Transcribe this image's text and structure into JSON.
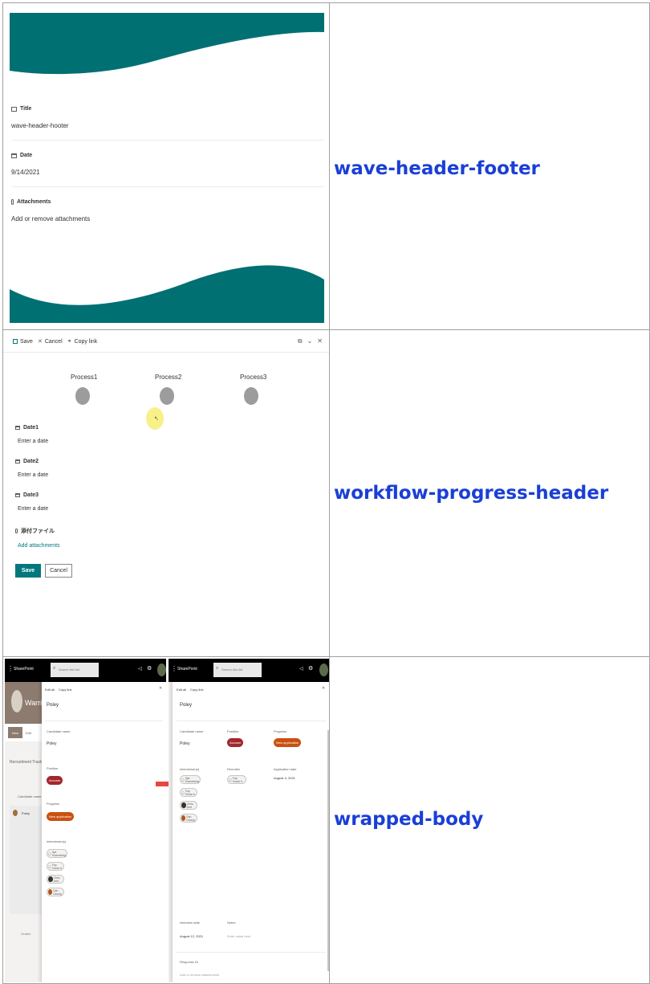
{
  "rows": [
    {
      "link": "wave-header-footer"
    },
    {
      "link": "workflow-progress-header"
    },
    {
      "link": "wrapped-body"
    }
  ],
  "wave": {
    "colors": {
      "teal": "#007073"
    },
    "fields": [
      {
        "label": "Title",
        "value": "wave-header-hooter",
        "icon": "text-field-icon"
      },
      {
        "label": "Date",
        "value": "9/14/2021",
        "icon": "calendar-icon"
      },
      {
        "label": "Attachments",
        "value": "Add or remove attachments",
        "icon": "paperclip-icon"
      }
    ]
  },
  "workflow": {
    "toolbar": {
      "save": "Save",
      "cancel": "Cancel",
      "copy_link": "Copy link"
    },
    "steps": [
      "Process1",
      "Process2",
      "Process3"
    ],
    "fields": [
      {
        "label": "Date1",
        "value": "Enter a date"
      },
      {
        "label": "Date2",
        "value": "Enter a date"
      },
      {
        "label": "Date3",
        "value": "Enter a date"
      },
      {
        "label": "添付ファイル",
        "value": "Add attachments"
      }
    ],
    "buttons": {
      "save": "Save",
      "cancel": "Cancel"
    },
    "colors": {
      "accent": "#03787c",
      "step": "#9c9c9c",
      "cursor": "#f6f07a"
    }
  },
  "wrapped": {
    "left": {
      "brand": "SharePoint",
      "search_placeholder": "Search this list",
      "site_name": "Warrior",
      "new_label": "New",
      "edit_label": "Edit",
      "list_title": "Recruitment Tracker",
      "col_header": "Candidate name",
      "row_name": "Poley",
      "footer": "Seattle",
      "toolbar": {
        "edit_all": "Edit all",
        "copy_link": "Copy link"
      },
      "title": "Poley",
      "fields": [
        {
          "label": "Candidate name",
          "value": "Poley"
        },
        {
          "label": "Position",
          "value": "Accuser"
        },
        {
          "label": "Progress",
          "value": "New application"
        },
        {
          "label": "Interviewer(s)",
          "people": [
            "Ilya Hoeneberg",
            "Fay Horse b",
            "Chris Arnt",
            "Dan Gaung"
          ]
        }
      ]
    },
    "right": {
      "brand": "SharePoint",
      "search_placeholder": "Search this list",
      "toolbar": {
        "edit_all": "Edit all",
        "copy_link": "Copy link"
      },
      "title": "Poley",
      "fields": [
        {
          "label": "Candidate name",
          "value": "Poley"
        },
        {
          "label": "Position",
          "value": "Accuser"
        },
        {
          "label": "Progress",
          "value": "New application"
        },
        {
          "label": "Interviewer(s)",
          "people": [
            "Ilya Hoeneberg",
            "Fay Horse b",
            "Chris Arnt",
            "Dan Gaung"
          ]
        },
        {
          "label": "Recruiter",
          "people": [
            "Fay Horse b"
          ]
        },
        {
          "label": "Application date",
          "value": "August 4, 2021"
        },
        {
          "label": "Interview date",
          "value": "August 12, 2021"
        },
        {
          "label": "Notes",
          "value": "Enter value here"
        },
        {
          "label": "Response ID",
          "value": "Add or remove attachments"
        }
      ]
    },
    "colors": {
      "position_chip": "#a4262c",
      "progress_chip": "#ca5010",
      "arrow": "#e8473f"
    }
  }
}
